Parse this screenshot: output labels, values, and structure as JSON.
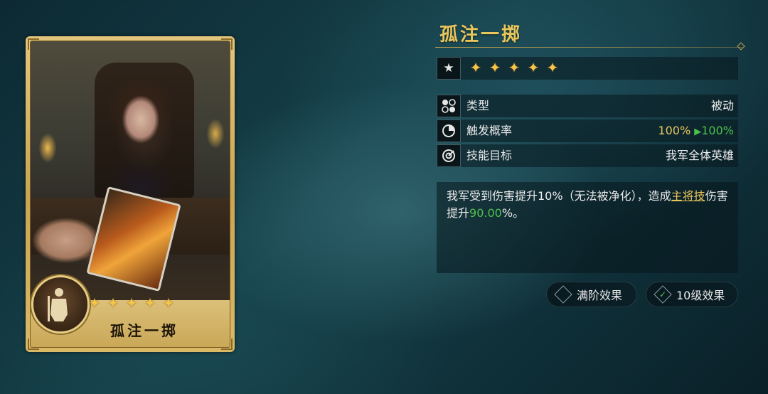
{
  "card": {
    "name": "孤注一掷",
    "stars": [
      "✦",
      "✦",
      "✦",
      "✦",
      "✦"
    ],
    "emblem_icon": "knight-emblem-icon"
  },
  "skill": {
    "title": "孤注一掷",
    "stars": [
      "✦",
      "✦",
      "✦",
      "✦",
      "✦"
    ],
    "rows": {
      "type": {
        "label": "类型",
        "value": "被动",
        "icon": "category-icon"
      },
      "trigger": {
        "label": "触发概率",
        "value_old": "100%",
        "arrow": "▶",
        "value_new": "100%",
        "icon": "probability-icon"
      },
      "target": {
        "label": "技能目标",
        "value": "我军全体英雄",
        "icon": "target-icon"
      }
    },
    "description": {
      "part1": "我军受到伤害提升10%（无法被净化），造成",
      "link": "主将技",
      "part2": "伤害提升",
      "number": "90.00",
      "part3": "%。"
    }
  },
  "buttons": {
    "max_effect": "满阶效果",
    "level10_effect": "10级效果",
    "check": "✓"
  },
  "colors": {
    "gold": "#e9c65c",
    "green": "#4cc24c",
    "panel_bg": "#08161c"
  }
}
